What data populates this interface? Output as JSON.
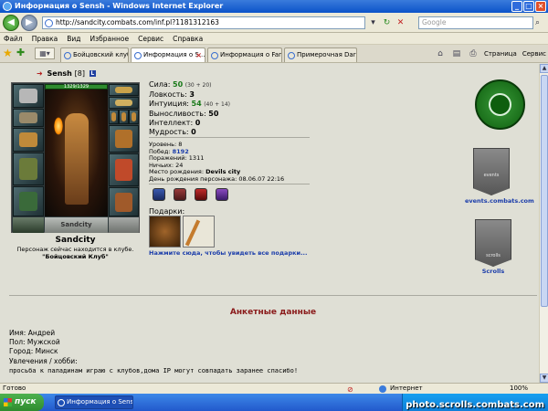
{
  "window": {
    "title": "Информация о Sensh - Windows Internet Explorer"
  },
  "address": {
    "url": "http://sandcity.combats.com/inf.pl?1181312163",
    "search_placeholder": "Google"
  },
  "menu": [
    "Файл",
    "Правка",
    "Вид",
    "Избранное",
    "Сервис",
    "Справка"
  ],
  "tabs": [
    {
      "label": "Бойцовский клуб"
    },
    {
      "label": "Информация о S..."
    },
    {
      "label": "Информация о Fanti..."
    },
    {
      "label": "Примерочная DarkClan"
    }
  ],
  "commands": {
    "page": "Страница",
    "service": "Сервис"
  },
  "character": {
    "name": "Sensh",
    "level": "[8]",
    "clan_flag": "L",
    "hp": "1329/1329",
    "crest_text": "Sandcity",
    "city": "Sandcity",
    "location_line1": "Персонаж сейчас находится в клубе.",
    "location_line2": "\"Бойцовский Клуб\""
  },
  "stats": [
    {
      "label": "Сила:",
      "value": "50",
      "bonus": "(30 + 20)",
      "style": "val"
    },
    {
      "label": "Ловкость:",
      "value": "3",
      "bonus": "",
      "style": "val"
    },
    {
      "label": "Интуиция:",
      "value": "54",
      "bonus": "(40 + 14)",
      "style": "val"
    },
    {
      "label": "Выносливость:",
      "value": "50",
      "bonus": "",
      "style": "val plain"
    },
    {
      "label": "Интеллект:",
      "value": "0",
      "bonus": "",
      "style": "val plain"
    },
    {
      "label": "Мудрость:",
      "value": "0",
      "bonus": "",
      "style": "val plain"
    }
  ],
  "records": {
    "level": {
      "label": "Уровень:",
      "value": "8"
    },
    "wins": {
      "label": "Побед:",
      "value": "8192"
    },
    "losses": {
      "label": "Поражений:",
      "value": "1311"
    },
    "draws": {
      "label": "Ничьих:",
      "value": "24"
    },
    "birthplace": {
      "label": "Место рождения:",
      "value": "Devils city"
    },
    "birthday": {
      "label": "День рождения персонажа:",
      "value": "08.06.07 22:16"
    }
  },
  "gifts": {
    "label": "Подарки:",
    "link": "Нажмите сюда, чтобы увидеть все подарки..."
  },
  "sidebar": {
    "events_caption": "events.combats.com",
    "events_banner_text": "events",
    "scrolls_caption": "Scrolls",
    "scrolls_banner_text": "scrolls"
  },
  "anketa": {
    "title": "Анкетные данные",
    "name_line": "Имя: Андрей",
    "gender_line": "Пол: Мужской",
    "city_line": "Город: Минск",
    "hobby_label": "Увлечения / хобби:",
    "hobby_text": "просьба к паладинам играю с клубов,дома IP могут совпадать заранее спасибо!"
  },
  "statusbar": {
    "status": "Готово",
    "zone": "Интернет",
    "zoom": "100%"
  },
  "taskbar": {
    "start": "пуск",
    "task": "Информация о Sensh...",
    "watermark": "photo.scrolls.combats.com"
  },
  "colors": {
    "accent_green": "#1a7a1a",
    "link_blue": "#1a3caa",
    "title_red": "#8a1a1a"
  }
}
